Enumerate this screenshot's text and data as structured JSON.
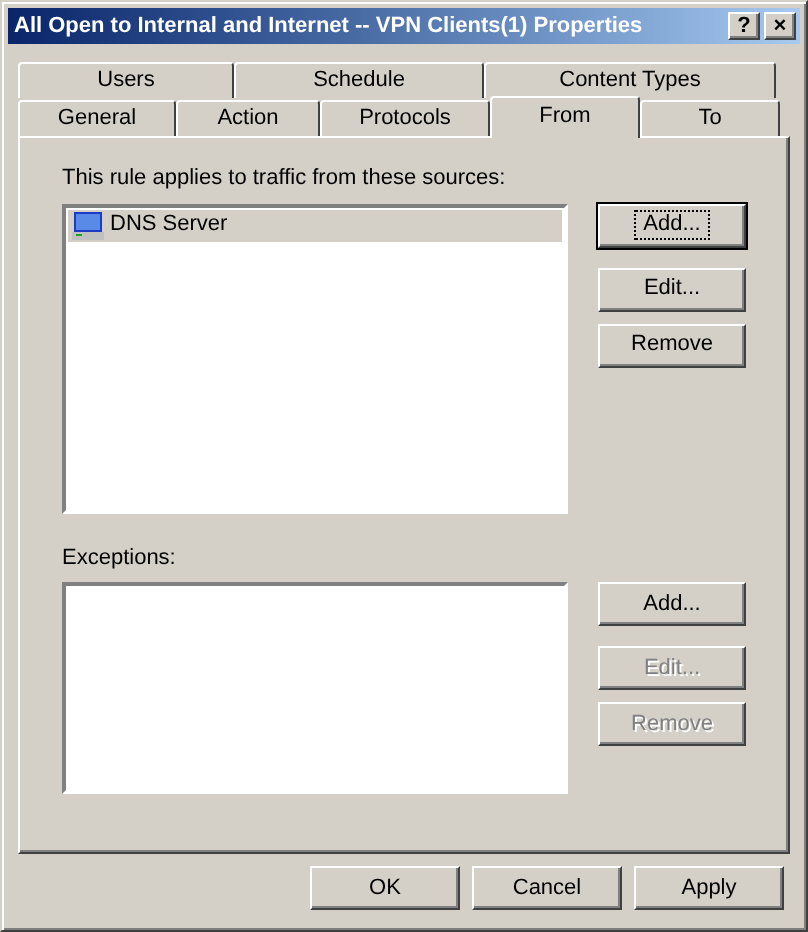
{
  "window": {
    "title": "All Open to Internal and Internet -- VPN Clients(1) Properties",
    "title_buttons": [
      "?",
      "×"
    ]
  },
  "tab_rows": [
    [
      {
        "label": "Users",
        "selected": false
      },
      {
        "label": "Schedule",
        "selected": false
      },
      {
        "label": "Content Types",
        "selected": false
      }
    ],
    [
      {
        "label": "General",
        "selected": false
      },
      {
        "label": "Action",
        "selected": false
      },
      {
        "label": "Protocols",
        "selected": false
      },
      {
        "label": "From",
        "selected": true
      },
      {
        "label": "To",
        "selected": false
      }
    ]
  ],
  "sources": {
    "caption": "This rule applies to traffic from these sources:",
    "items": [
      {
        "label": "DNS Server",
        "selected": true
      }
    ],
    "buttons": [
      {
        "label": "Add...",
        "disabled": false,
        "focused": true
      },
      {
        "label": "Edit...",
        "disabled": false,
        "focused": false
      },
      {
        "label": "Remove",
        "disabled": false,
        "focused": false
      }
    ]
  },
  "exceptions": {
    "caption": "Exceptions:",
    "buttons": [
      {
        "label": "Add...",
        "disabled": false,
        "focused": false
      },
      {
        "label": "Edit...",
        "disabled": true,
        "focused": false
      },
      {
        "label": "Remove",
        "disabled": true,
        "focused": false
      }
    ]
  },
  "footer_buttons": [
    {
      "label": "OK",
      "disabled": false,
      "focused": false
    },
    {
      "label": "Cancel",
      "disabled": false,
      "focused": false
    },
    {
      "label": "Apply",
      "disabled": false,
      "focused": false
    }
  ]
}
